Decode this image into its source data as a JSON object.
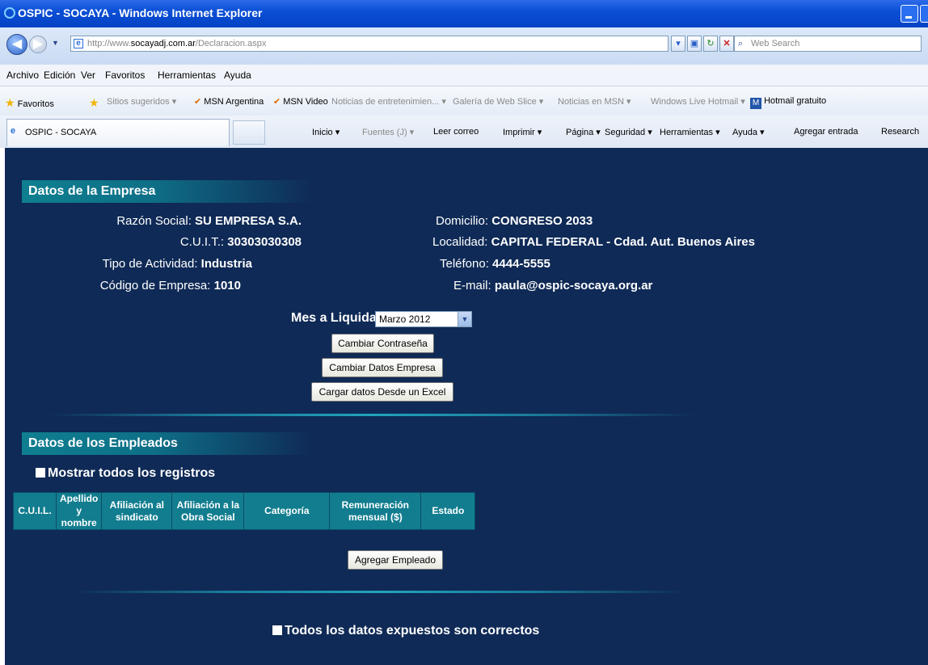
{
  "window": {
    "title": "OSPIC - SOCAYA - Windows Internet Explorer"
  },
  "address": {
    "prefix": "http://www.",
    "host": "socayadj.com.ar",
    "path": "/Declaracion.aspx"
  },
  "search": {
    "placeholder": "Web Search"
  },
  "menu": [
    "Archivo",
    "Edición",
    "Ver",
    "Favoritos",
    "Herramientas",
    "Ayuda"
  ],
  "favorites": {
    "label": "Favoritos",
    "items": [
      "Sitios sugeridos ▾",
      "MSN Argentina",
      "MSN Video",
      "Noticias de entretenimien... ▾",
      "Galería de Web Slice ▾",
      "Noticias en MSN ▾",
      "Windows Live Hotmail ▾",
      "Hotmail gratuito"
    ]
  },
  "tab": {
    "title": "OSPIC - SOCAYA"
  },
  "commandbar": [
    "Inicio ▾",
    "Fuentes (J) ▾",
    "Leer correo",
    "Imprimir ▾",
    "Página ▾",
    "Seguridad ▾",
    "Herramientas ▾",
    "Ayuda ▾",
    "Agregar entrada",
    "Research"
  ],
  "empresa": {
    "header": "Datos de la Empresa",
    "razon_label": "Razón Social: ",
    "razon_value": "SU EMPRESA S.A.",
    "cuit_label": "C.U.I.T.: ",
    "cuit_value": "30303030308",
    "actividad_label": "Tipo de Actividad: ",
    "actividad_value": "Industria",
    "codigo_label": "Código de Empresa: ",
    "codigo_value": "1010",
    "domicilio_label": "Domicilio: ",
    "domicilio_value": "CONGRESO 2033",
    "localidad_label": "Localidad: ",
    "localidad_value": "CAPITAL FEDERAL - Cdad. Aut. Buenos Aires",
    "telefono_label": "Teléfono: ",
    "telefono_value": "4444-5555",
    "email_label": "E-mail: ",
    "email_value": "paula@ospic-socaya.org.ar"
  },
  "liquidar": {
    "label": "Mes a Liquidar:",
    "selected": "Marzo 2012"
  },
  "buttons": {
    "cambiar_contrasena": "Cambiar Contraseña",
    "cambiar_datos": "Cambiar Datos Empresa",
    "cargar_excel": "Cargar datos Desde un Excel",
    "agregar_empleado": "Agregar Empleado"
  },
  "empleados": {
    "header": "Datos de los Empleados",
    "mostrar_todos": "Mostrar todos los registros",
    "columns": [
      [
        "C.U.I.L."
      ],
      [
        "Apellido",
        "y nombre"
      ],
      [
        "Afiliación al",
        "sindicato"
      ],
      [
        "Afiliación a la",
        "Obra Social"
      ],
      [
        "Categoría"
      ],
      [
        "Remuneración",
        "mensual ($)"
      ],
      [
        "Estado"
      ]
    ]
  },
  "confirm": "Todos los datos expuestos son correctos"
}
